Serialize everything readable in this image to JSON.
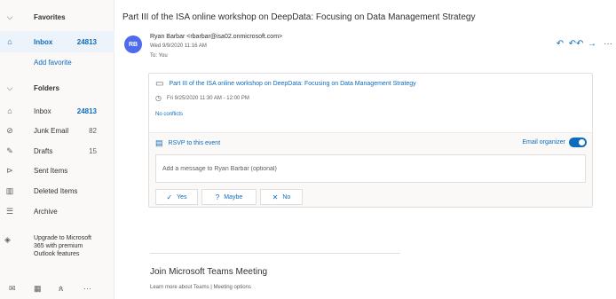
{
  "sidebar": {
    "favorites": {
      "label": "Favorites"
    },
    "inbox_fav": {
      "label": "Inbox",
      "count": "24813"
    },
    "add_favorite": "Add favorite",
    "folders": {
      "label": "Folders"
    },
    "folder_items": [
      {
        "label": "Inbox",
        "count": "24813",
        "icon": "inbox-icon"
      },
      {
        "label": "Junk Email",
        "count": "82",
        "icon": "junk-icon"
      },
      {
        "label": "Drafts",
        "count": "15",
        "icon": "pencil-icon"
      },
      {
        "label": "Sent Items",
        "count": "",
        "icon": "send-icon"
      },
      {
        "label": "Deleted Items",
        "count": "",
        "icon": "trash-icon"
      },
      {
        "label": "Archive",
        "count": "",
        "icon": "archive-icon"
      }
    ],
    "upgrade_text": "Upgrade to Microsoft 365 with premium Outlook features",
    "bottom_icons": [
      "mail-icon",
      "calendar-icon",
      "people-icon",
      "more-icon"
    ]
  },
  "message": {
    "subject": "Part III of the ISA online workshop on DeepData: Focusing on Data Management Strategy",
    "avatar_initials": "RB",
    "sender": "Ryan Barbar <rbarbar@isa02.onmicrosoft.com>",
    "date": "Wed 9/9/2020 11:16 AM",
    "to": "To: You"
  },
  "actions": {
    "reply_icon": "↶",
    "reply_all_icon": "↶↶",
    "forward_icon": "→",
    "more_icon": "···"
  },
  "event": {
    "title": "Part III of the ISA online workshop on DeepData: Focusing on Data Management Strategy",
    "time": "Fri 9/25/2020 11:30 AM - 12:00 PM",
    "conflicts": "No conflicts",
    "rsvp_label": "RSVP to this event",
    "email_organizer": "Email organizer",
    "email_organizer_on": true,
    "message_placeholder": "Add a message to Ryan Barbar (optional)",
    "buttons": {
      "yes": "Yes",
      "maybe": "Maybe",
      "no": "No"
    }
  },
  "teams": {
    "title": "Join Microsoft Teams Meeting",
    "learn_more": "Learn more about Teams",
    "separator": "|",
    "meeting_options": "Meeting options"
  },
  "colors": {
    "accent": "#0f6cbd",
    "avatar": "#4f6bed"
  }
}
